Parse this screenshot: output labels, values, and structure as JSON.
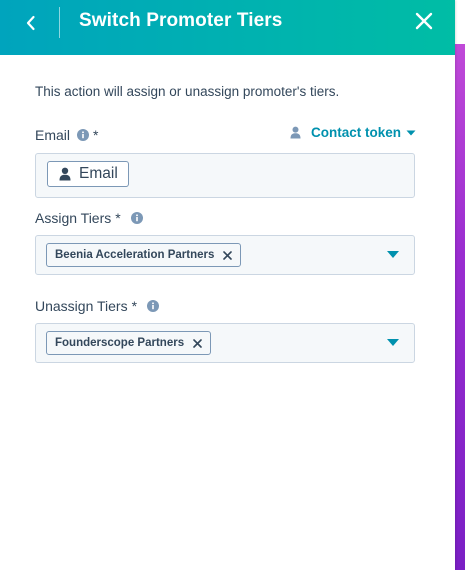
{
  "header": {
    "title": "Switch Promoter Tiers",
    "back_icon": "chevron-left-icon",
    "close_icon": "close-icon"
  },
  "description": "This action will assign or unassign promoter's tiers.",
  "email": {
    "label": "Email",
    "required_mark": "*",
    "contact_token_label": "Contact token",
    "token_pill_label": "Email"
  },
  "assign_tiers": {
    "label": "Assign Tiers",
    "required_mark": "*",
    "selected": [
      "Beenia Acceleration Partners"
    ]
  },
  "unassign_tiers": {
    "label": "Unassign Tiers",
    "required_mark": "*",
    "selected": [
      "Founderscope Partners"
    ]
  },
  "colors": {
    "header_gradient_start": "#00a4bd",
    "header_gradient_end": "#00bda5",
    "link": "#0091ae",
    "text": "#33475b",
    "field_bg": "#f5f8fa",
    "field_border": "#cbd6e2"
  }
}
